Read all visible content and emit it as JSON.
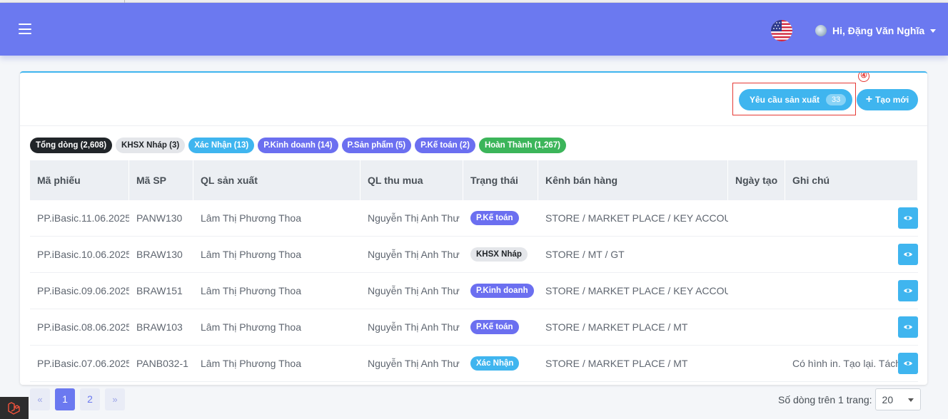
{
  "header": {
    "user_greeting": "Hi, Đặng Văn Nghĩa",
    "flag": "us-flag-icon"
  },
  "toolbar": {
    "step_marker": "④",
    "request_label": "Yêu cầu sản xuất",
    "request_count": "33",
    "new_label": "Tạo mới"
  },
  "filters": [
    {
      "label": "Tổng dòng (2,608)",
      "bg": "#212529",
      "fg": "#ffffff"
    },
    {
      "label": "KHSX Nháp (3)",
      "bg": "#e4e6ea",
      "fg": "#212529"
    },
    {
      "label": "Xác Nhận (13)",
      "bg": "#3fb5ef",
      "fg": "#ffffff"
    },
    {
      "label": "P.Kinh doanh (14)",
      "bg": "#6b6ff0",
      "fg": "#ffffff"
    },
    {
      "label": "P.Sản phẩm (5)",
      "bg": "#6b6ff0",
      "fg": "#ffffff"
    },
    {
      "label": "P.Kế toán (2)",
      "bg": "#6b6ff0",
      "fg": "#ffffff"
    },
    {
      "label": "Hoàn Thành (1,267)",
      "bg": "#3cb55a",
      "fg": "#ffffff"
    }
  ],
  "table": {
    "columns": [
      "Mã phiếu",
      "Mã SP",
      "QL sản xuất",
      "QL thu mua",
      "Trạng thái",
      "Kênh bán hàng",
      "Ngày tạo",
      "Ghi chú"
    ],
    "rows": [
      {
        "ma_phieu": "PP.iBasic.11.06.2025",
        "ma_sp": "PANW130",
        "ql_sx": "Lâm Thị Phương Thoa",
        "ql_tm": "Nguyễn Thị Anh Thư",
        "status": "P.Kế toán",
        "status_bg": "#6b6ff0",
        "status_fg": "#ffffff",
        "kenh": "STORE / MARKET PLACE / KEY ACCOUNT",
        "ngay_tao": "",
        "ghi_chu": ""
      },
      {
        "ma_phieu": "PP.iBasic.10.06.2025",
        "ma_sp": "BRAW130",
        "ql_sx": "Lâm Thị Phương Thoa",
        "ql_tm": "Nguyễn Thị Anh Thư",
        "status": "KHSX Nháp",
        "status_bg": "#e4e6ea",
        "status_fg": "#212529",
        "kenh": "STORE / MT / GT",
        "ngay_tao": "",
        "ghi_chu": ""
      },
      {
        "ma_phieu": "PP.iBasic.09.06.2025",
        "ma_sp": "BRAW151",
        "ql_sx": "Lâm Thị Phương Thoa",
        "ql_tm": "Nguyễn Thị Anh Thư",
        "status": "P.Kinh doanh",
        "status_bg": "#6b6ff0",
        "status_fg": "#ffffff",
        "kenh": "STORE / MARKET PLACE / KEY ACCOUNT",
        "ngay_tao": "",
        "ghi_chu": ""
      },
      {
        "ma_phieu": "PP.iBasic.08.06.2025",
        "ma_sp": "BRAW103",
        "ql_sx": "Lâm Thị Phương Thoa",
        "ql_tm": "Nguyễn Thị Anh Thư",
        "status": "P.Kế toán",
        "status_bg": "#6b6ff0",
        "status_fg": "#ffffff",
        "kenh": "STORE / MARKET PLACE / MT",
        "ngay_tao": "",
        "ghi_chu": ""
      },
      {
        "ma_phieu": "PP.iBasic.07.06.2025",
        "ma_sp": "PANB032-1",
        "ql_sx": "Lâm Thị Phương Thoa",
        "ql_tm": "Nguyễn Thị Anh Thư",
        "status": "Xác Nhận",
        "status_bg": "#3fb5ef",
        "status_fg": "#ffffff",
        "kenh": "STORE / MARKET PLACE / MT",
        "ngay_tao": "",
        "ghi_chu": "Có hình in. Tạo lại. Tách"
      }
    ]
  },
  "pagination": {
    "prev": "«",
    "pages": [
      "1",
      "2"
    ],
    "next": "»",
    "per_page_label": "Số dòng trên 1 trang:",
    "per_page_value": "20"
  }
}
